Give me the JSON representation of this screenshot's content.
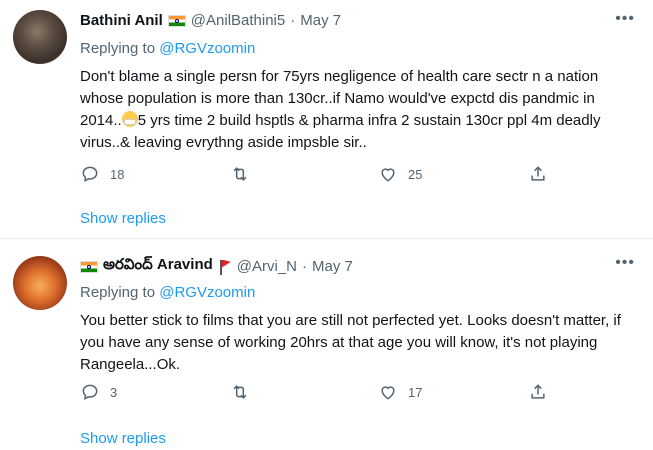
{
  "tweets": [
    {
      "name": "Bathini Anil",
      "handle": "@AnilBathini5",
      "dot": "·",
      "date": "May 7",
      "more": "•••",
      "replying_prefix": "Replying to",
      "replying_to": "@RGVzoomin",
      "text_part1": "Don't blame a single persn for 75yrs negligence of health care sectr n a nation whose population is more than 130cr..if Namo would've expctd dis pandmic in 2014..",
      "emoji": "face-with-medical-mask",
      "text_part2": "5 yrs time 2 build hsptls & pharma infra 2 sustain 130cr ppl 4m deadly virus..& leaving evrythng aside impsble sir..",
      "reply_count": "18",
      "retweet_count": "",
      "like_count": "25",
      "show_replies": "Show replies"
    },
    {
      "name": "అరవింద్ Aravind",
      "handle": "@Arvi_N",
      "dot": "·",
      "date": "May 7",
      "more": "•••",
      "replying_prefix": "Replying to",
      "replying_to": "@RGVzoomin",
      "text": "You better stick to films that you are still not perfected yet. Looks doesn't matter, if you have any sense of working 20hrs at that age you will know, it's not playing Rangeela...Ok.",
      "reply_count": "3",
      "retweet_count": "",
      "like_count": "17",
      "show_replies": "Show replies"
    }
  ],
  "colors": {
    "accent": "#1d9bf0",
    "muted": "#536471",
    "text": "#0f1419",
    "divider": "#e6ecf0"
  },
  "icons": [
    "reply-icon",
    "retweet-icon",
    "like-icon",
    "share-icon",
    "more-icon",
    "india-flag-icon",
    "red-flag-icon"
  ]
}
